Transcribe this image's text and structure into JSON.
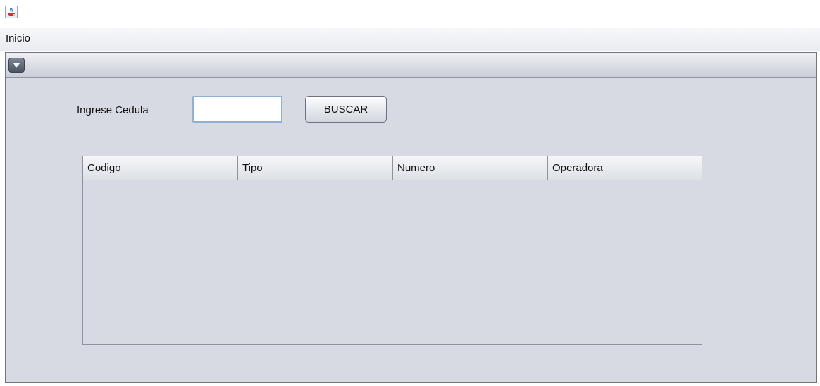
{
  "window": {
    "icon": "java-coffee-cup-icon"
  },
  "menubar": {
    "items": [
      {
        "label": "Inicio"
      }
    ]
  },
  "internal_frame": {
    "menu_button_icon": "chevron-down-icon"
  },
  "form": {
    "cedula_label": "Ingrese Cedula",
    "cedula_value": "",
    "search_button_label": "BUSCAR"
  },
  "table": {
    "columns": [
      {
        "label": "Codigo"
      },
      {
        "label": "Tipo"
      },
      {
        "label": "Numero"
      },
      {
        "label": "Operadora"
      }
    ],
    "rows": []
  },
  "colors": {
    "panel_background": "#d7dae2",
    "input_focus_border": "#8fb0d4"
  }
}
